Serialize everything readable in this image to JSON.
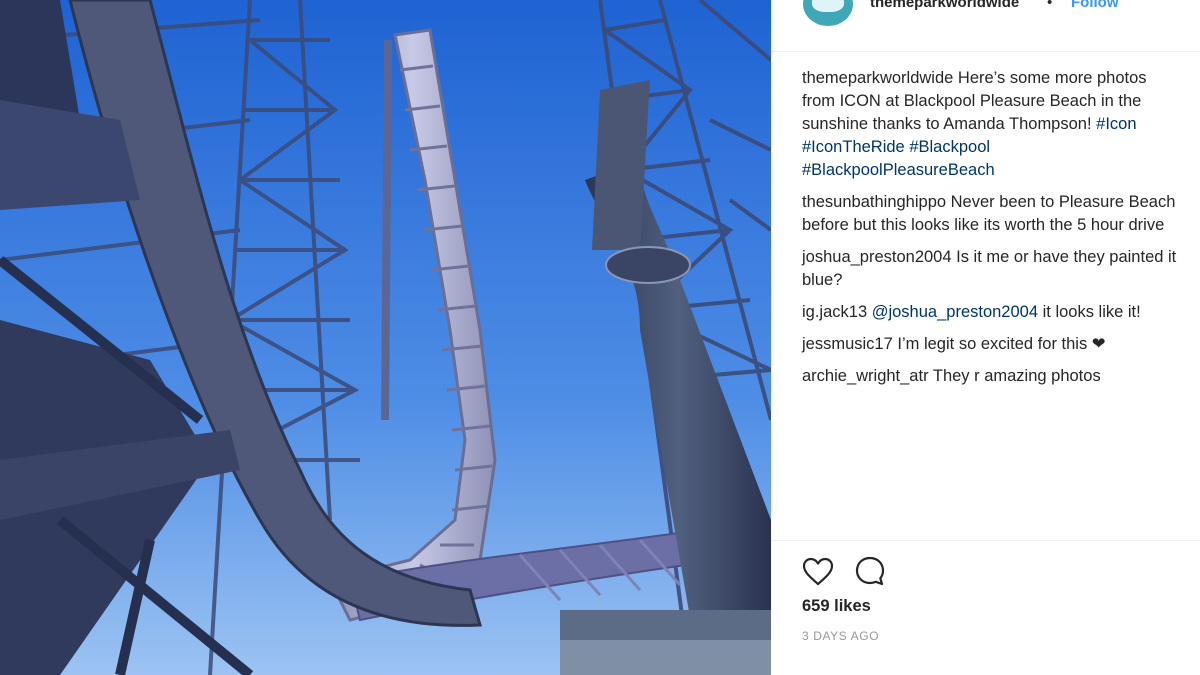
{
  "post": {
    "image_alt": "ICON roller coaster at Blackpool Pleasure Beach",
    "header": {
      "username": "themeparkworldwide",
      "separator": "•",
      "follow_label": "Follow"
    },
    "caption": {
      "username": "themeparkworldwide",
      "text": "Here’s some more photos from ICON at Blackpool Pleasure Beach in the sunshine thanks to Amanda Thompson!",
      "hashtags": [
        "#Icon",
        "#IconTheRide",
        "#Blackpool",
        "#BlackpoolPleasureBeach"
      ]
    },
    "comments": [
      {
        "username": "thesunbathinghippo",
        "text": "Never been to Pleasure Beach before but this looks like its worth the 5 hour drive"
      },
      {
        "username": "joshua_preston2004",
        "text": "Is it me or have they painted it blue?"
      },
      {
        "username": "ig.jack13",
        "mention": "@joshua_preston2004",
        "text": "it looks like it!"
      },
      {
        "username": "jessmusic17",
        "text": "I’m legit so excited for this ❤"
      },
      {
        "username": "archie_wright_atr",
        "text": "They r amazing photos"
      }
    ],
    "actions": {
      "like_icon": "heart-outline-icon",
      "comment_icon": "speech-bubble-icon"
    },
    "likes": "659 likes",
    "time_ago": "3 DAYS AGO"
  },
  "colors": {
    "link": "#003569",
    "follow": "#3897f0",
    "muted": "#999999",
    "sky": "#2a6fd6"
  }
}
